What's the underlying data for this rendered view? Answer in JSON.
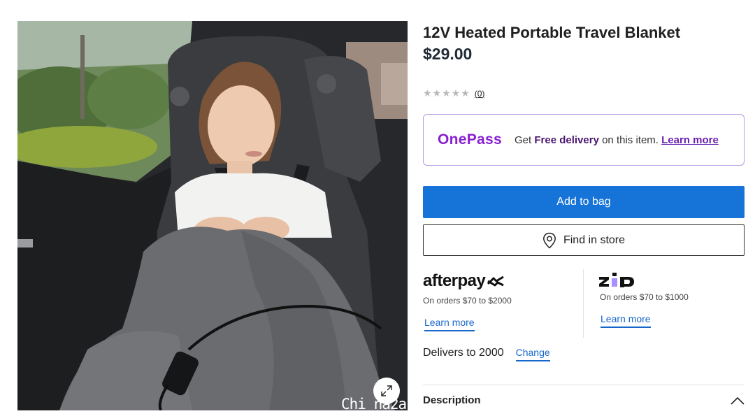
{
  "product": {
    "title": "12V Heated Portable Travel Blanket",
    "price": "$29.00",
    "rating_stars": "★★★★★",
    "review_count": "(0)"
  },
  "image": {
    "watermark": "Chi na2a"
  },
  "onepass": {
    "logo": "OnePass",
    "text_prefix": "Get ",
    "text_bold": "Free delivery",
    "text_suffix": " on this item. ",
    "learn_more": "Learn more",
    "accent": "#8a1fd2"
  },
  "actions": {
    "add_to_bag": "Add to bag",
    "find_in_store": "Find in store",
    "primary_color": "#1673d8"
  },
  "payments": {
    "afterpay": {
      "logo": "afterpay",
      "terms": "On orders $70 to $2000",
      "learn_more": "Learn more"
    },
    "zip": {
      "logo": "zip",
      "terms": "On orders $70 to $1000",
      "learn_more": "Learn more"
    }
  },
  "delivery": {
    "text": "Delivers to 2000",
    "change": "Change"
  },
  "description": {
    "title": "Description",
    "icon": "chevron-up-icon"
  }
}
